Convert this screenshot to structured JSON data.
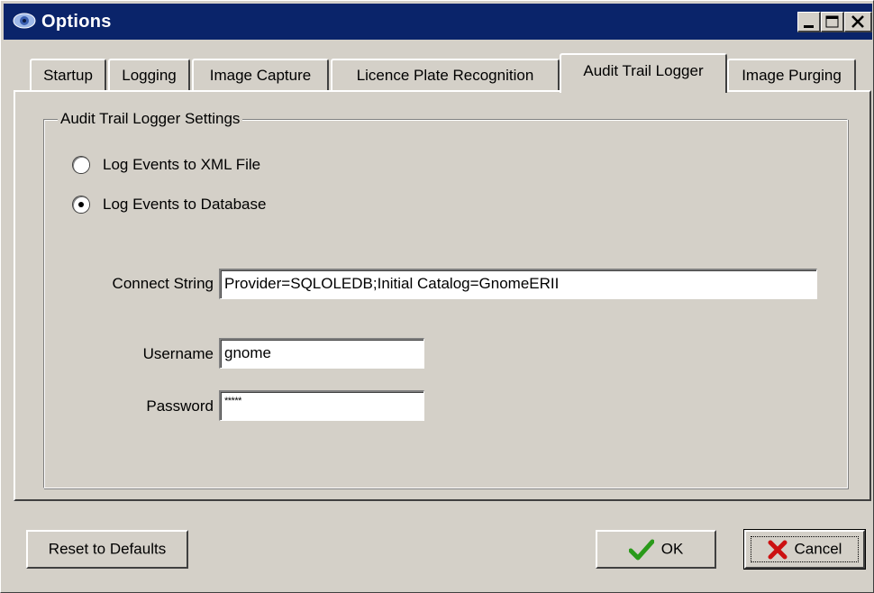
{
  "window": {
    "title": "Options"
  },
  "tabs": [
    {
      "label": "Startup",
      "active": false
    },
    {
      "label": "Logging",
      "active": false
    },
    {
      "label": "Image Capture",
      "active": false
    },
    {
      "label": "Licence Plate Recognition",
      "active": false
    },
    {
      "label": "Audit Trail Logger",
      "active": true
    },
    {
      "label": "Image Purging",
      "active": false
    }
  ],
  "audit": {
    "group_title": "Audit Trail Logger Settings",
    "options": [
      {
        "label": "Log Events to XML File",
        "selected": false
      },
      {
        "label": "Log Events to Database",
        "selected": true
      }
    ],
    "connect_label": "Connect String",
    "connect_value": "Provider=SQLOLEDB;Initial Catalog=GnomeERII",
    "username_label": "Username",
    "username_value": "gnome",
    "password_label": "Password",
    "password_value": "*****"
  },
  "buttons": {
    "reset": "Reset to Defaults",
    "ok": "OK",
    "cancel": "Cancel"
  },
  "colors": {
    "titlebar": "#0a246a",
    "face": "#d4d0c8",
    "ok_check": "#2a9a1a",
    "cancel_x": "#cc1111"
  }
}
